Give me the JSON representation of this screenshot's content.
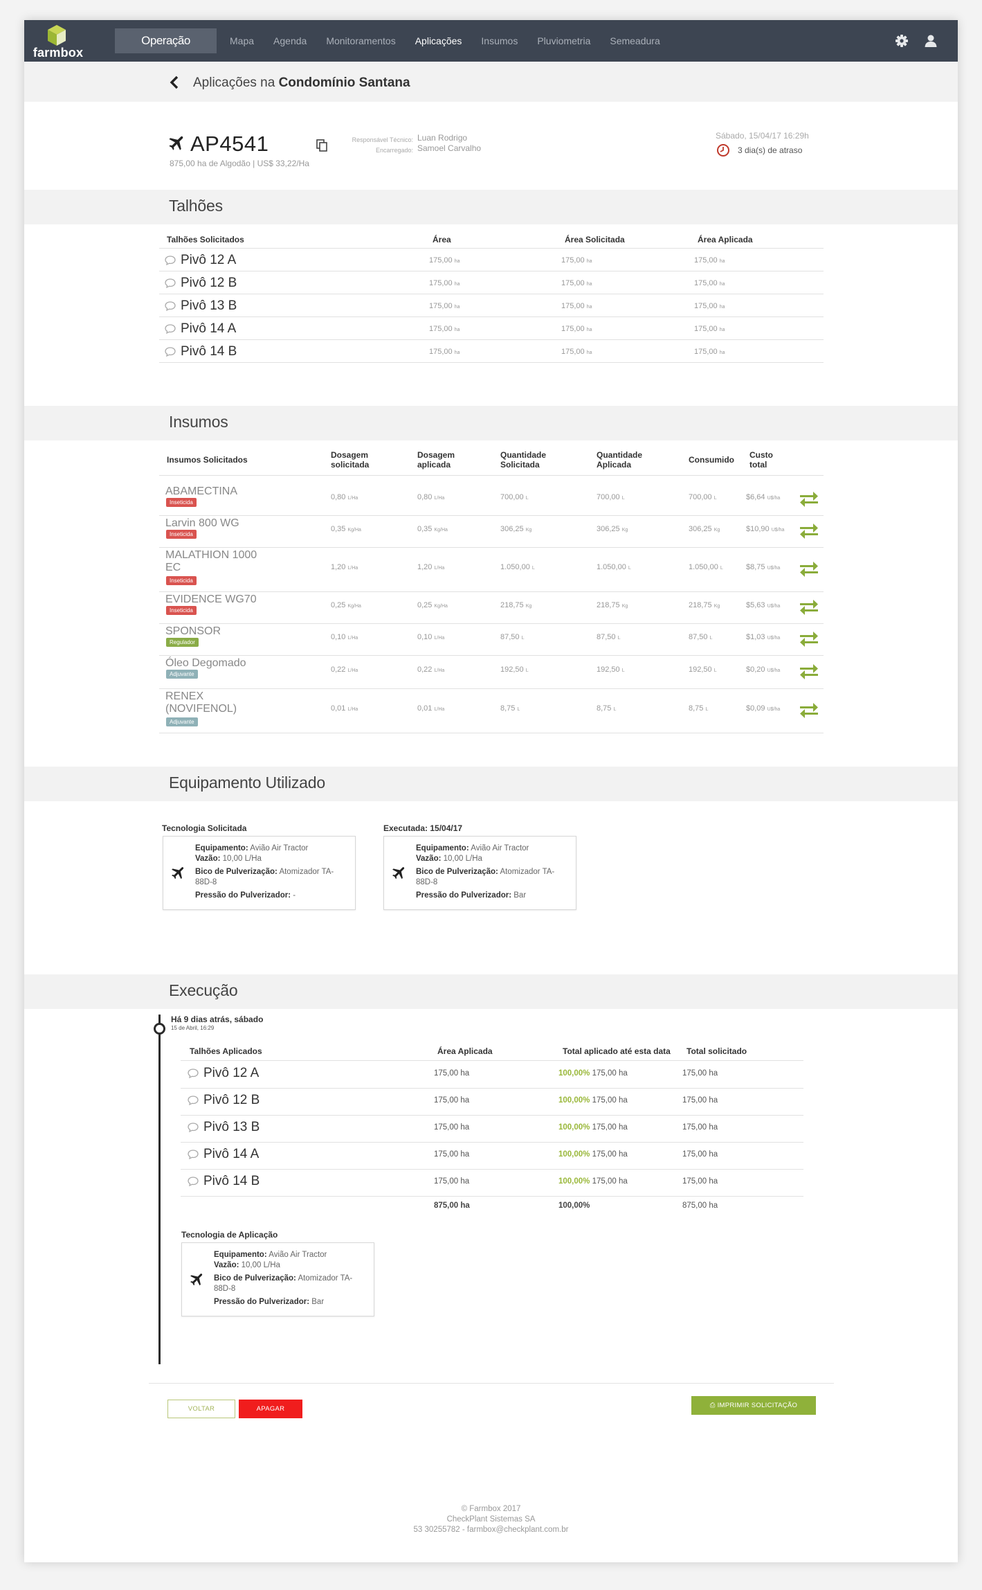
{
  "topbar": {
    "logo": "farmbox",
    "operation_button": "Operação",
    "nav": [
      "Mapa",
      "Agenda",
      "Monitoramentos",
      "Aplicações",
      "Insumos",
      "Pluviometria",
      "Semeadura"
    ],
    "active_nav": "Aplicações",
    "icons": [
      "gear-icon",
      "user-icon"
    ]
  },
  "header": {
    "title_prefix": "Aplicações na ",
    "title_farm": "Condomínio Santana"
  },
  "application": {
    "code": "AP4541",
    "summary": "875,00 ha de Algodão | US$ 33,22/Ha",
    "tech_label": "Responsável Técnico:",
    "tech_name": "Luan Rodrigo",
    "foreman_label": "Encarregado:",
    "foreman_name": "Samoel Carvalho",
    "date": "Sábado, 15/04/17 16:29h",
    "delay": "3 dia(s) de atraso"
  },
  "talhoes": {
    "title": "Talhões",
    "headers": [
      "Talhões Solicitados",
      "Área",
      "Área Solicitada",
      "Área Aplicada"
    ],
    "unit": "ha",
    "rows": [
      {
        "name": "Pivô 12 A",
        "area": "175,00",
        "solicitada": "175,00",
        "aplicada": "175,00"
      },
      {
        "name": "Pivô 12 B",
        "area": "175,00",
        "solicitada": "175,00",
        "aplicada": "175,00"
      },
      {
        "name": "Pivô 13 B",
        "area": "175,00",
        "solicitada": "175,00",
        "aplicada": "175,00"
      },
      {
        "name": "Pivô 14 A",
        "area": "175,00",
        "solicitada": "175,00",
        "aplicada": "175,00"
      },
      {
        "name": "Pivô 14 B",
        "area": "175,00",
        "solicitada": "175,00",
        "aplicada": "175,00"
      }
    ]
  },
  "insumos": {
    "title": "Insumos",
    "headers": {
      "name": "Insumos Solicitados",
      "dos_sol": [
        "Dosagem",
        "solicitada"
      ],
      "dos_apl": [
        "Dosagem",
        "aplicada"
      ],
      "qtd_sol": [
        "Quantidade",
        "Solicitada"
      ],
      "qtd_apl": [
        "Quantidade",
        "Aplicada"
      ],
      "consumido": "Consumido",
      "custo": [
        "Custo",
        "total"
      ]
    },
    "rows": [
      {
        "name": "ABAMECTINA",
        "badge": "Inseticida",
        "dos_sol": "0,80",
        "dos_sol_u": "L/Ha",
        "dos_apl": "0,80",
        "dos_apl_u": "L/Ha",
        "qtd_sol": "700,00",
        "qtd_sol_u": "L",
        "qtd_apl": "700,00",
        "qtd_apl_u": "L",
        "consumido": "700,00",
        "consumido_u": "L",
        "custo": "$6,64",
        "custo_u": "U$/ha"
      },
      {
        "name": "Larvin 800 WG",
        "badge": "Inseticida",
        "dos_sol": "0,35",
        "dos_sol_u": "Kg/Ha",
        "dos_apl": "0,35",
        "dos_apl_u": "Kg/Ha",
        "qtd_sol": "306,25",
        "qtd_sol_u": "Kg",
        "qtd_apl": "306,25",
        "qtd_apl_u": "Kg",
        "consumido": "306,25",
        "consumido_u": "Kg",
        "custo": "$10,90",
        "custo_u": "U$/ha"
      },
      {
        "name": "MALATHION 1000 EC",
        "badge": "Inseticida",
        "dos_sol": "1,20",
        "dos_sol_u": "L/Ha",
        "dos_apl": "1,20",
        "dos_apl_u": "L/Ha",
        "qtd_sol": "1.050,00",
        "qtd_sol_u": "L",
        "qtd_apl": "1.050,00",
        "qtd_apl_u": "L",
        "consumido": "1.050,00",
        "consumido_u": "L",
        "custo": "$8,75",
        "custo_u": "U$/ha"
      },
      {
        "name": "EVIDENCE WG70",
        "badge": "Inseticida",
        "dos_sol": "0,25",
        "dos_sol_u": "Kg/Ha",
        "dos_apl": "0,25",
        "dos_apl_u": "Kg/Ha",
        "qtd_sol": "218,75",
        "qtd_sol_u": "Kg",
        "qtd_apl": "218,75",
        "qtd_apl_u": "Kg",
        "consumido": "218,75",
        "consumido_u": "Kg",
        "custo": "$5,63",
        "custo_u": "U$/ha"
      },
      {
        "name": "SPONSOR",
        "badge": "Regulador",
        "dos_sol": "0,10",
        "dos_sol_u": "L/Ha",
        "dos_apl": "0,10",
        "dos_apl_u": "L/Ha",
        "qtd_sol": "87,50",
        "qtd_sol_u": "L",
        "qtd_apl": "87,50",
        "qtd_apl_u": "L",
        "consumido": "87,50",
        "consumido_u": "L",
        "custo": "$1,03",
        "custo_u": "U$/ha"
      },
      {
        "name": "Óleo Degomado",
        "badge": "Adjuvante",
        "dos_sol": "0,22",
        "dos_sol_u": "L/Ha",
        "dos_apl": "0,22",
        "dos_apl_u": "L/Ha",
        "qtd_sol": "192,50",
        "qtd_sol_u": "L",
        "qtd_apl": "192,50",
        "qtd_apl_u": "L",
        "consumido": "192,50",
        "consumido_u": "L",
        "custo": "$0,20",
        "custo_u": "U$/ha"
      },
      {
        "name": "RENEX (NOVIFENOL)",
        "badge": "Adjuvante",
        "dos_sol": "0,01",
        "dos_sol_u": "L/Ha",
        "dos_apl": "0,01",
        "dos_apl_u": "L/Ha",
        "qtd_sol": "8,75",
        "qtd_sol_u": "L",
        "qtd_apl": "8,75",
        "qtd_apl_u": "L",
        "consumido": "8,75",
        "consumido_u": "L",
        "custo": "$0,09",
        "custo_u": "U$/ha"
      }
    ],
    "badge_colors": {
      "Inseticida": "#d9534f",
      "Regulador": "#8aac47",
      "Adjuvante": "#8fb1b7"
    }
  },
  "equipment": {
    "title": "Equipamento Utilizado",
    "requested_label": "Tecnologia Solicitada",
    "executed_label": "Executada: 15/04/17",
    "field_equip": "Equipamento:",
    "field_flow": "Vazão:",
    "field_nozzle": "Bico de Pulverização:",
    "field_pressure": "Pressão do Pulverizador:",
    "requested": {
      "equip": "Avião Air Tractor",
      "flow": "10,00 L/Ha",
      "nozzle": "Atomizador TA-88D-8",
      "pressure": "-"
    },
    "executed": {
      "equip": "Avião Air Tractor",
      "flow": "10,00 L/Ha",
      "nozzle": "Atomizador TA-88D-8",
      "pressure": "Bar"
    }
  },
  "execution": {
    "title": "Execução",
    "event_title": "Há 9 dias atrás, sábado",
    "event_date": "15 de Abril, 16:29",
    "headers": [
      "Talhões Aplicados",
      "Área Aplicada",
      "Total aplicado até esta data",
      "Total solicitado"
    ],
    "rows": [
      {
        "name": "Pivô 12 A",
        "area": "175,00 ha",
        "pct": "100,00%",
        "applied": "175,00 ha",
        "requested": "175,00 ha"
      },
      {
        "name": "Pivô 12 B",
        "area": "175,00 ha",
        "pct": "100,00%",
        "applied": "175,00 ha",
        "requested": "175,00 ha"
      },
      {
        "name": "Pivô 13 B",
        "area": "175,00 ha",
        "pct": "100,00%",
        "applied": "175,00 ha",
        "requested": "175,00 ha"
      },
      {
        "name": "Pivô 14 A",
        "area": "175,00 ha",
        "pct": "100,00%",
        "applied": "175,00 ha",
        "requested": "175,00 ha"
      },
      {
        "name": "Pivô 14 B",
        "area": "175,00 ha",
        "pct": "100,00%",
        "applied": "175,00 ha",
        "requested": "175,00 ha"
      }
    ],
    "totals": {
      "area": "875,00 ha",
      "pct": "100,00%",
      "requested": "875,00 ha"
    },
    "tech_label": "Tecnologia de Aplicação",
    "tech": {
      "equip": "Avião Air Tractor",
      "flow": "10,00 L/Ha",
      "nozzle": "Atomizador TA-88D-8",
      "pressure": "Bar"
    }
  },
  "actions": {
    "back": "VOLTAR",
    "delete": "APAGAR",
    "print": "IMPRIMIR SOLICITAÇÃO"
  },
  "footer": {
    "line1": "© Farmbox 2017",
    "line2": "CheckPlant Sistemas SA",
    "line3": "53 30255782 - farmbox@checkplant.com.br"
  },
  "colors": {
    "topbar": "#3d4552",
    "accent_green": "#8fb13a",
    "delete_red": "#f01d1d",
    "delay_red": "#c0392b"
  }
}
